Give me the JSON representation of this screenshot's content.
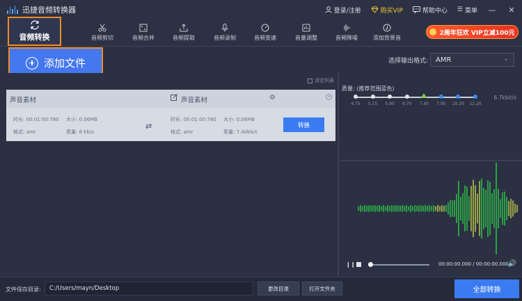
{
  "app": {
    "title": "迅捷音频转换器"
  },
  "titlebar": {
    "login": "登录/注册",
    "vip": "购买VIP",
    "help": "帮助中心",
    "menu": "菜单"
  },
  "toolbar": {
    "main": "音频转换",
    "tools": [
      {
        "label": "音频剪切",
        "icon": "scissors-icon"
      },
      {
        "label": "音频合并",
        "icon": "merge-icon"
      },
      {
        "label": "音频提取",
        "icon": "extract-icon"
      },
      {
        "label": "音频录制",
        "icon": "microphone-icon"
      },
      {
        "label": "音频变速",
        "icon": "speed-icon"
      },
      {
        "label": "音量调整",
        "icon": "volume-adjust-icon"
      },
      {
        "label": "音频降噪",
        "icon": "denoise-icon"
      },
      {
        "label": "添加背景音",
        "icon": "music-note-icon"
      }
    ],
    "promo": "2周年狂欢 VIP立减100元"
  },
  "actionbar": {
    "add_file": "添加文件",
    "format_label": "选择输出格式:",
    "format_value": "AMR"
  },
  "filelist": {
    "clear": "清空列表",
    "item": {
      "source": {
        "title": "声音素材",
        "duration": "时长: 00:01:00:780",
        "size": "大小: 0.06MB",
        "format": "格式: amr",
        "quality": "质量: 8 kb/s"
      },
      "target": {
        "title": "声音素材",
        "duration": "时长: 00:01:00:780",
        "size": "大小: 0.06MB",
        "format": "格式: amr",
        "quality": "质量: 7.40kb/s"
      },
      "convert": "转换"
    }
  },
  "quality": {
    "label": "质量: (推荐范围蓝色)",
    "current": "6.7kbit/s",
    "ticks": [
      "4.75",
      "5.15",
      "5.90",
      "6.70",
      "7.40",
      "7.95",
      "10.20",
      "12.20"
    ],
    "selected_index": 4,
    "recommended_indices": [
      4,
      5,
      6,
      7
    ],
    "colors": {
      "recommended": "#3a8cf5",
      "selected": "#7dd34b"
    }
  },
  "player": {
    "time": "00:00:00.000 / 00:00:00.000"
  },
  "footer": {
    "save_label": "文件保存目录:",
    "save_path": "C:/Users/mayn/Desktop",
    "change_dir": "更改目录",
    "open_folder": "打开文件夹",
    "convert_all": "全部转换"
  },
  "colors": {
    "accent": "#3b7bf2",
    "highlight_border": "#f08c2a",
    "vip": "#f5c33b",
    "wave_green": "#2ecf4a",
    "wave_yellow": "#c9d64a"
  }
}
